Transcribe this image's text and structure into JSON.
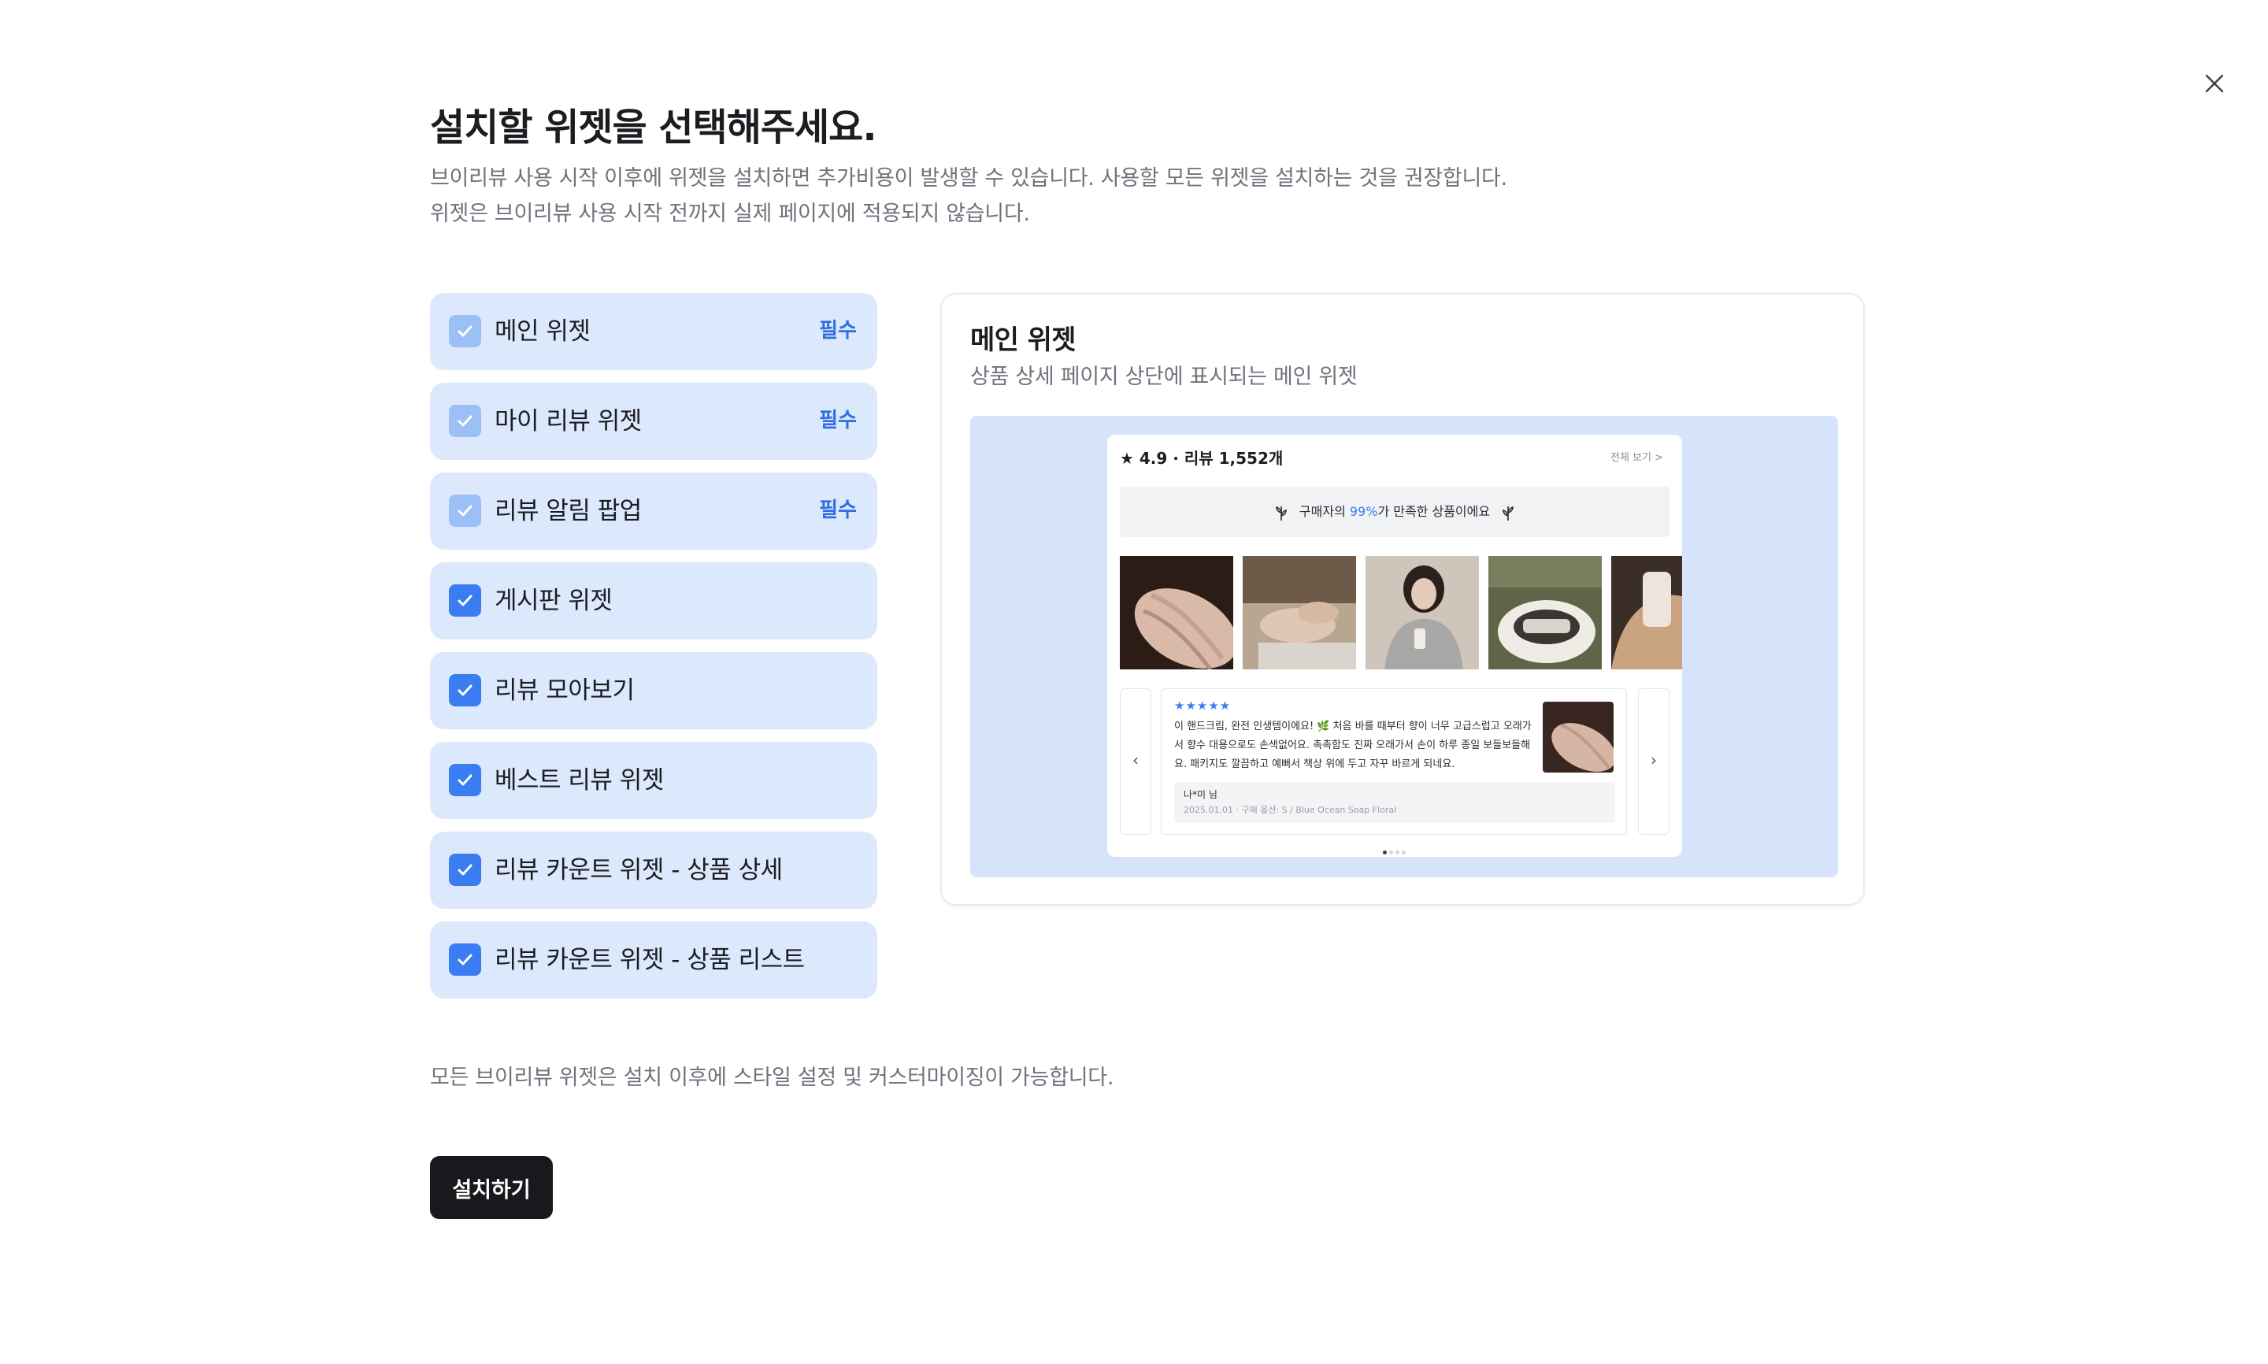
{
  "title": "설치할 위젯을 선택해주세요.",
  "description_lines": [
    "브이리뷰 사용 시작 이후에 위젯을 설치하면 추가비용이 발생할 수 있습니다. 사용할 모든 위젯을 설치하는 것을 권장합니다.",
    "위젯은 브이리뷰 사용 시작 전까지 실제 페이지에 적용되지 않습니다."
  ],
  "widgets": [
    {
      "label": "메인 위젯",
      "checked": true,
      "required": true,
      "badge": "필수"
    },
    {
      "label": "마이 리뷰 위젯",
      "checked": true,
      "required": true,
      "badge": "필수"
    },
    {
      "label": "리뷰 알림 팝업",
      "checked": true,
      "required": true,
      "badge": "필수"
    },
    {
      "label": "게시판 위젯",
      "checked": true,
      "required": false
    },
    {
      "label": "리뷰 모아보기",
      "checked": true,
      "required": false
    },
    {
      "label": "베스트 리뷰 위젯",
      "checked": true,
      "required": false
    },
    {
      "label": "리뷰 카운트 위젯 - 상품 상세",
      "checked": true,
      "required": false
    },
    {
      "label": "리뷰 카운트 위젯 - 상품 리스트",
      "checked": true,
      "required": false
    }
  ],
  "preview": {
    "title": "메인 위젯",
    "subtitle": "상품 상세 페이지 상단에 표시되는 메인 위젯",
    "mock": {
      "rating": "★ 4.9 · 리뷰 1,552개",
      "view_all": "전체 보기 >",
      "banner_pre": "구매자의 ",
      "banner_pct": "99%",
      "banner_post": "가 만족한 상품이에요",
      "stars": "★★★★★",
      "review_text": "이 핸드크림, 완전 인생템이에요! 🌿 처음 바를 때부터 향이 너무 고급스럽고 오래가서 향수 대용으로도 손색없어요. 촉촉함도 진짜 오래가서 손이 하루 종일 보들보들해요. 패키지도 깔끔하고 예뻐서 책상 위에 두고 자꾸 바르게 되네요.",
      "reviewer": "나*미 님",
      "review_meta": "2025.01.01 · 구매 옵션: S / Blue Ocean Soap Floral",
      "prev_arrow": "‹",
      "next_arrow": "›"
    }
  },
  "footnote": "모든 브이리뷰 위젯은 설치 이후에 스타일 설정 및 커스터마이징이 가능합니다.",
  "install_button": "설치하기",
  "colors": {
    "accent": "#3a7df2",
    "accent_disabled": "#9cc0f6",
    "item_bg": "#dce8fc",
    "preview_bg": "#d6e3fb",
    "button_bg": "#18191c"
  }
}
